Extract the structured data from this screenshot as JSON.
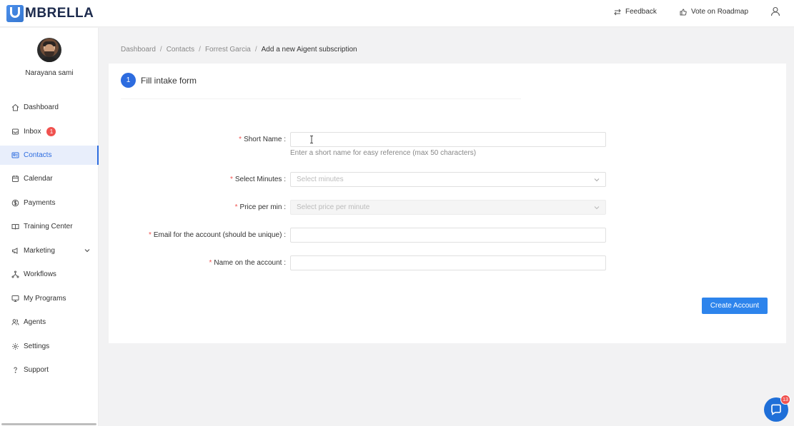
{
  "brand": {
    "name": "MBRELLA",
    "accent": "#2d6cdf"
  },
  "header": {
    "feedback_label": "Feedback",
    "roadmap_label": "Vote on Roadmap"
  },
  "user": {
    "name": "Narayana sami"
  },
  "sidebar": {
    "items": [
      {
        "label": "Dashboard",
        "icon": "home-icon"
      },
      {
        "label": "Inbox",
        "icon": "inbox-icon",
        "badge": "1"
      },
      {
        "label": "Contacts",
        "icon": "contacts-icon",
        "active": true
      },
      {
        "label": "Calendar",
        "icon": "calendar-icon"
      },
      {
        "label": "Payments",
        "icon": "payments-icon"
      },
      {
        "label": "Training Center",
        "icon": "book-icon"
      },
      {
        "label": "Marketing",
        "icon": "megaphone-icon",
        "expandable": true
      },
      {
        "label": "Workflows",
        "icon": "workflow-icon"
      },
      {
        "label": "My Programs",
        "icon": "monitor-icon"
      },
      {
        "label": "Agents",
        "icon": "agents-icon"
      },
      {
        "label": "Settings",
        "icon": "gear-icon"
      },
      {
        "label": "Support",
        "icon": "question-icon"
      }
    ]
  },
  "breadcrumb": {
    "items": [
      "Dashboard",
      "Contacts",
      "Forrest Garcia"
    ],
    "current": "Add a new Aigent subscription",
    "separator": "/"
  },
  "form": {
    "step_number": "1",
    "step_title": "Fill intake form",
    "required_marker": "*",
    "fields": {
      "short_name": {
        "label": "Short Name :",
        "value": "",
        "helper": "Enter a short name for easy reference (max 50 characters)"
      },
      "select_minutes": {
        "label": "Select Minutes :",
        "placeholder": "Select minutes"
      },
      "price_per_min": {
        "label": "Price per min :",
        "placeholder": "Select price per minute",
        "disabled": true
      },
      "email": {
        "label": "Email for the account (should be unique) :",
        "value": ""
      },
      "account_name": {
        "label": "Name on the account :",
        "value": ""
      }
    },
    "submit_label": "Create Account"
  },
  "chat": {
    "badge": "13"
  }
}
